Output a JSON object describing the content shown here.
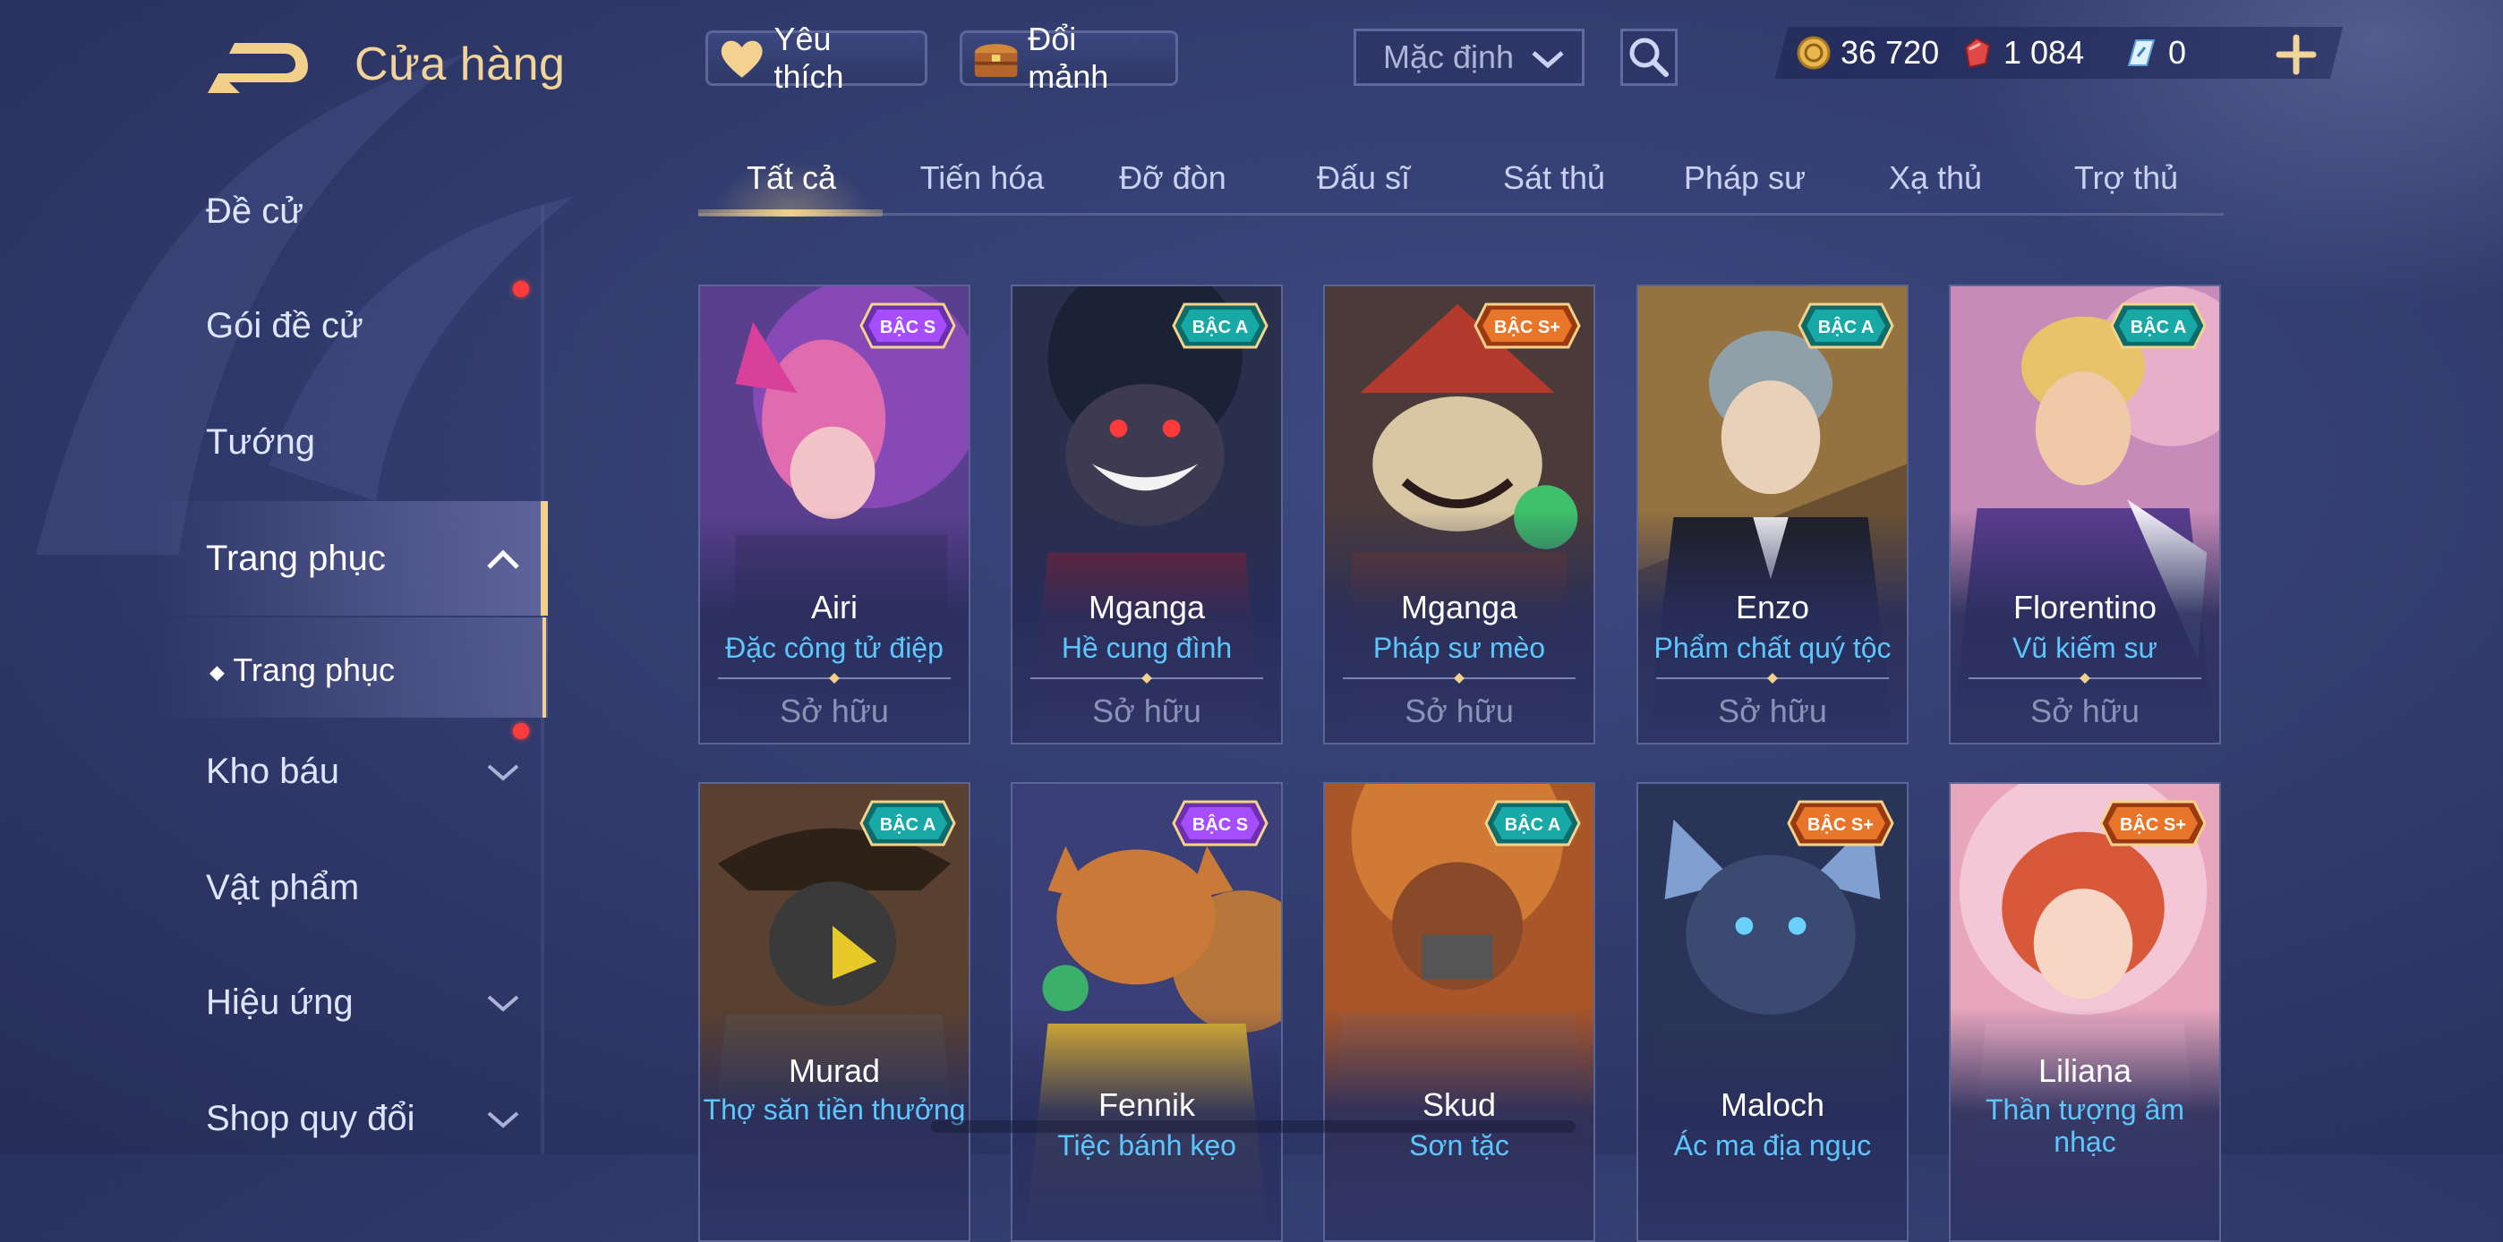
{
  "header": {
    "title": "Cửa hàng",
    "favorite_label": "Yêu thích",
    "exchange_label": "Đổi mảnh",
    "sort_value": "Mặc định",
    "currencies": {
      "gold": "36 720",
      "voucher": "1 084",
      "ticket": "0"
    }
  },
  "sidebar": {
    "items": [
      {
        "label": "Đề cử"
      },
      {
        "label": "Gói đề cử"
      },
      {
        "label": "Tướng"
      },
      {
        "label": "Trang phục"
      },
      {
        "label": "Kho báu"
      },
      {
        "label": "Vật phẩm"
      },
      {
        "label": "Hiệu ứng"
      },
      {
        "label": "Shop quy đổi"
      }
    ],
    "sub_item": "Trang phục"
  },
  "tabs": [
    "Tất cả",
    "Tiến hóa",
    "Đỡ đòn",
    "Đấu sĩ",
    "Sát thủ",
    "Pháp sư",
    "Xạ thủ",
    "Trợ thủ"
  ],
  "cards": [
    {
      "hero": "Airi",
      "skin": "Đặc công tử điệp",
      "status": "Sở hữu",
      "tier": "BẬC S",
      "tier_color": "#a64dff"
    },
    {
      "hero": "Mganga",
      "skin": "Hề cung đình",
      "status": "Sở hữu",
      "tier": "BẬC A",
      "tier_color": "#18a9a6"
    },
    {
      "hero": "Mganga",
      "skin": "Pháp sư mèo",
      "status": "Sở hữu",
      "tier": "BẬC S+",
      "tier_color": "#e8762a"
    },
    {
      "hero": "Enzo",
      "skin": "Phẩm chất quý tộc",
      "status": "Sở hữu",
      "tier": "BẬC A",
      "tier_color": "#18a9a6"
    },
    {
      "hero": "Florentino",
      "skin": "Vũ kiếm sư",
      "status": "Sở hữu",
      "tier": "BẬC A",
      "tier_color": "#18a9a6"
    },
    {
      "hero": "Murad",
      "skin": "Thợ săn tiền thưởng",
      "status": "",
      "tier": "BẬC A",
      "tier_color": "#18a9a6"
    },
    {
      "hero": "Fennik",
      "skin": "Tiệc bánh kẹo",
      "status": "",
      "tier": "BẬC S",
      "tier_color": "#a64dff"
    },
    {
      "hero": "Skud",
      "skin": "Sơn tặc",
      "status": "",
      "tier": "BẬC A",
      "tier_color": "#18a9a6"
    },
    {
      "hero": "Maloch",
      "skin": "Ác ma địa ngục",
      "status": "",
      "tier": "BẬC S+",
      "tier_color": "#e8762a"
    },
    {
      "hero": "Liliana",
      "skin": "Thần tượng âm nhạc",
      "status": "",
      "tier": "BẬC S+",
      "tier_color": "#e8762a"
    }
  ],
  "colors": {
    "accent_gold": "#f0d08a",
    "skin_name": "#5cc7ff",
    "notification": "#ff3b3b"
  }
}
